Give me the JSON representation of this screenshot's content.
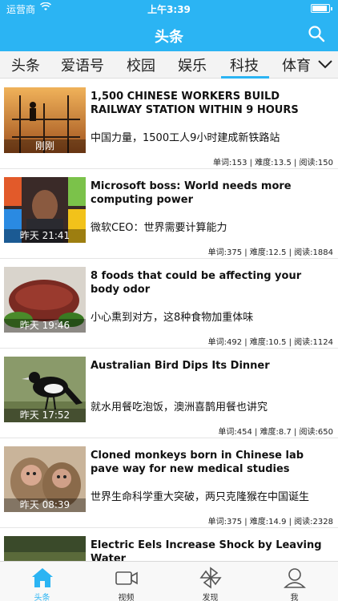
{
  "status": {
    "carrier": "运营商",
    "time": "上午3:39"
  },
  "navbar": {
    "title": "头条"
  },
  "tabs": [
    "头条",
    "爱语号",
    "校园",
    "娱乐",
    "科技",
    "体育"
  ],
  "articles": [
    {
      "en": "1,500 CHINESE WORKERS BUILD RAILWAY STATION WITHIN 9 HOURS",
      "zh": "中国力量，1500工人9小时建成新铁路站",
      "time": "刚刚",
      "meta": "单词:153 | 难度:13.5 | 阅读:150"
    },
    {
      "en": "Microsoft boss: World needs more computing power",
      "zh": "微软CEO：世界需要计算能力",
      "time": "昨天 21:41",
      "meta": "单词:375 | 难度:12.5 | 阅读:1884"
    },
    {
      "en": "8 foods that could be affecting your body odor",
      "zh": "小心熏到对方，这8种食物加重体味",
      "time": "昨天 19:46",
      "meta": "单词:492 | 难度:10.5 | 阅读:1124"
    },
    {
      "en": "Australian Bird Dips Its Dinner",
      "zh": "就水用餐吃泡饭，澳洲喜鹊用餐也讲究",
      "time": "昨天 17:52",
      "meta": "单词:454 | 难度:8.7 | 阅读:650"
    },
    {
      "en": "Cloned monkeys born in Chinese lab pave way for new medical studies",
      "zh": "世界生命科学重大突破，两只克隆猴在中国诞生",
      "time": "昨天 08:39",
      "meta": "单词:375 | 难度:14.9 | 阅读:2328"
    },
    {
      "en": "Electric Eels Increase Shock by Leaving Water",
      "zh": "",
      "time": "",
      "meta": ""
    }
  ],
  "tabbar": [
    "头条",
    "视频",
    "发现",
    "我"
  ],
  "colors": {
    "accent": "#2bb4f3"
  }
}
